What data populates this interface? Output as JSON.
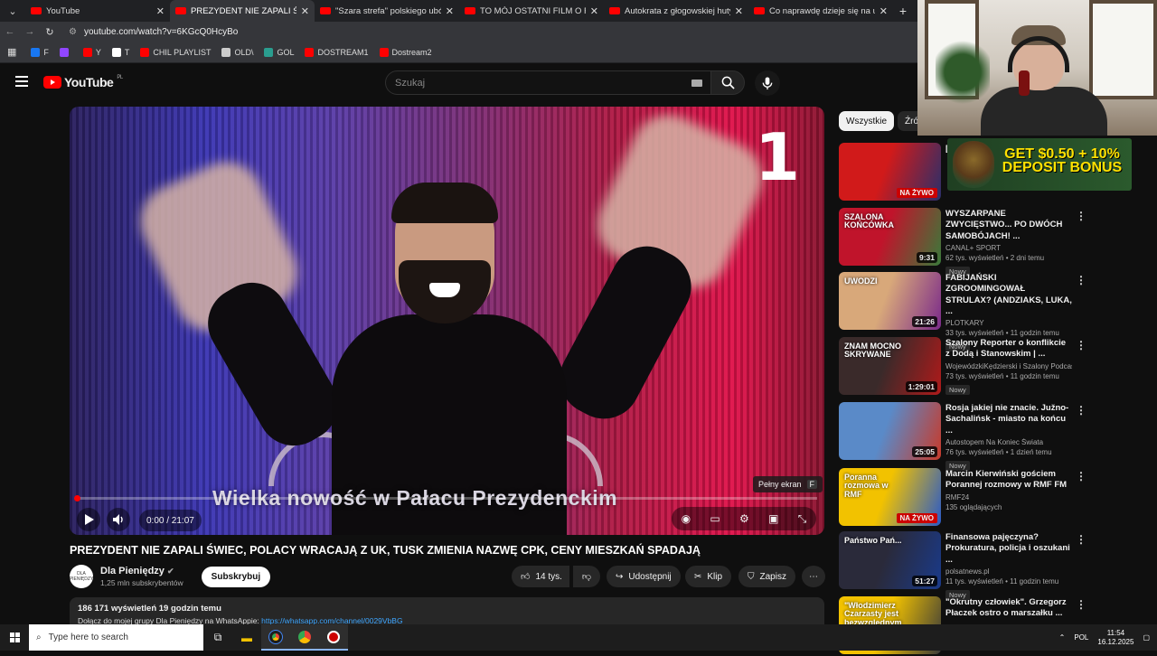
{
  "browser": {
    "tabs": [
      {
        "title": "YouTube",
        "active": false
      },
      {
        "title": "PREZYDENT NIE ZAPALI ŚWIEC",
        "active": true
      },
      {
        "title": "\"Szara strefa\" polskiego ubóst",
        "active": false
      },
      {
        "title": "TO MÓJ OSTATNI FILM O FAZIE",
        "active": false
      },
      {
        "title": "Autokrata z głogowskiej huty w",
        "active": false
      },
      {
        "title": "Co naprawdę dzieje się na uzbe",
        "active": false
      }
    ],
    "url": "youtube.com/watch?v=6KGcQ0HcyBo",
    "bookmarks": [
      {
        "label": "F",
        "color": "#1877f2"
      },
      {
        "label": "",
        "color": "#9146ff"
      },
      {
        "label": "Y",
        "color": "#ff0000"
      },
      {
        "label": "T",
        "color": "#ffffff"
      },
      {
        "label": "CHIL PLAYLIST",
        "color": "#ff0000"
      },
      {
        "label": "OLD\\",
        "color": "#cccccc"
      },
      {
        "label": "GOL",
        "color": "#2a9d8f"
      },
      {
        "label": "DOSTREAM1",
        "color": "#ff0000"
      },
      {
        "label": "Dostream2",
        "color": "#ff0000"
      }
    ]
  },
  "youtube": {
    "logo": "YouTube",
    "logo_region": "PL",
    "search_placeholder": "Szukaj"
  },
  "player": {
    "overlay_number": "1",
    "caption": "Wielka nowość w Pałacu Prezydenckim",
    "tooltip_label": "Pełny ekran",
    "tooltip_key": "F",
    "time": "0:00 / 21:07",
    "progress": 0
  },
  "video": {
    "title": "PREZYDENT NIE ZAPALI ŚWIEC, POLACY WRACAJĄ Z UK, TUSK ZMIENIA NAZWĘ CPK, CENY MIESZKAŃ SPADAJĄ",
    "channel": "Dla Pieniędzy",
    "channel_avatar_text": "DLA PIENIĘDZY",
    "subscribers": "1,25 mln subskrybentów",
    "subscribe_label": "Subskrybuj",
    "likes": "14 tys.",
    "share_label": "Udostępnij",
    "clip_label": "Klip",
    "save_label": "Zapisz",
    "views_line": "186 171 wyświetleń  19 godzin temu",
    "desc_text": "Dołącz do mojej grupy Dla Pieniędzy na WhatsAppie:",
    "desc_link": "https://whatsapp.com/channel/0029VbBG"
  },
  "sidebar": {
    "chips": [
      "Wszystkie",
      "Źró"
    ],
    "recommendations": [
      {
        "title": "[",
        "channel": "",
        "meta": "",
        "badge": "NA ŻYWO",
        "duration": "",
        "thumb_text": "",
        "thumb_colors": [
          "#d11a1a",
          "#2a2f6a"
        ],
        "new": false
      },
      {
        "title": "WYSZARPANE ZWYCIĘSTWO... PO DWÓCH SAMOBÓJACH! ...",
        "channel": "CANAL+ SPORT",
        "meta": "62 tys. wyświetleń • 2 dni temu",
        "badge": "",
        "duration": "9:31",
        "thumb_text": "SZALONA KOŃCÓWKA",
        "thumb_colors": [
          "#c0142b",
          "#3a7a3a"
        ],
        "new": true
      },
      {
        "title": "FABIJAŃSKI ZGROOMINGOWAŁ STRULAX? (ANDZIAKS, LUKA, ...",
        "channel": "PLOTKARY",
        "meta": "33 tys. wyświetleń • 11 godzin temu",
        "badge": "",
        "duration": "21:26",
        "thumb_text": "UWODZI",
        "thumb_colors": [
          "#d8a87a",
          "#7a2a8a"
        ],
        "new": true
      },
      {
        "title": "Szalony Reporter o konflikcie z Dodą i Stanowskim | ...",
        "channel": "WojewódzkiKędzierski i Szalony Podcast.",
        "meta": "73 tys. wyświetleń • 11 godzin temu",
        "badge": "",
        "duration": "1:29:01",
        "thumb_text": "ZNAM MOCNO SKRYWANE",
        "thumb_colors": [
          "#3a2a2a",
          "#b01a1a"
        ],
        "new": true
      },
      {
        "title": "Rosja jakiej nie znacie. Južno-Sachalińsk - miasto na końcu ...",
        "channel": "Autostopem Na Koniec Świata",
        "meta": "76 tys. wyświetleń • 1 dzień temu",
        "badge": "",
        "duration": "25:05",
        "thumb_text": "",
        "thumb_colors": [
          "#5a8ac8",
          "#c83a2a"
        ],
        "new": true
      },
      {
        "title": "Marcin Kierwiński gościem Porannej rozmowy w RMF FM",
        "channel": "RMF24",
        "meta": "135 oglądających",
        "badge": "NA ŻYWO",
        "duration": "",
        "thumb_text": "Poranna rozmowa w RMF",
        "thumb_colors": [
          "#f2c200",
          "#2a5ac8"
        ],
        "new": false
      },
      {
        "title": "Finansowa pajęczyna? Prokuratura, policja i oszukani ...",
        "channel": "polsatnews.pl",
        "meta": "11 tys. wyświetleń • 11 godzin temu",
        "badge": "",
        "duration": "51:27",
        "thumb_text": "Państwo Pań...",
        "thumb_colors": [
          "#2a2a3a",
          "#1a3a8a"
        ],
        "new": true
      },
      {
        "title": "\"Okrutny człowiek\". Grzegorz Płaczek ostro o marszałku ...",
        "channel": "",
        "meta": "",
        "badge": "",
        "duration": "",
        "thumb_text": "\"Włodzimierz Czarzasty jest bezwzględnym politykiem\"",
        "thumb_colors": [
          "#f2c200",
          "#3a3a3a"
        ],
        "new": false
      }
    ]
  },
  "ad": {
    "text": "GET $0.50 + 10% DEPOSIT BONUS"
  },
  "taskbar": {
    "search_placeholder": "Type here to search",
    "lang": "POL",
    "time": "11:54",
    "date": "16.12.2025"
  }
}
